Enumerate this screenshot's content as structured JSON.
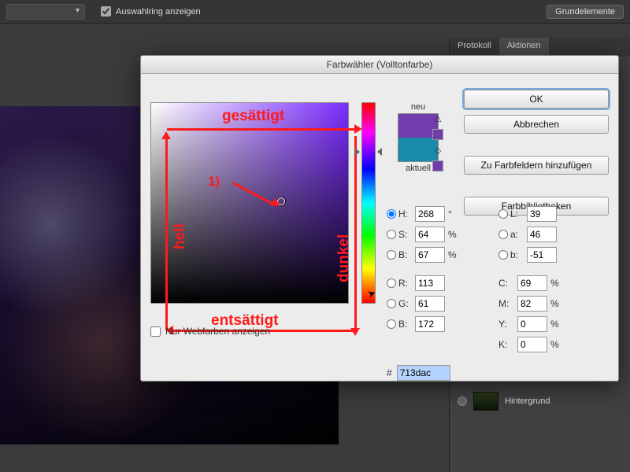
{
  "topbar": {
    "checkbox_label": "Auswahlring anzeigen",
    "right_button": "Grundelemente"
  },
  "panel": {
    "tabs": [
      "Protokoll",
      "Aktionen"
    ],
    "active_tab": 1,
    "layer_name": "Hintergrund"
  },
  "dialog": {
    "title": "Farbwähler (Volltonfarbe)",
    "buttons": {
      "ok": "OK",
      "cancel": "Abbrechen",
      "add_swatch": "Zu Farbfeldern hinzufügen",
      "libraries": "Farbbibliotheken"
    },
    "swatch": {
      "new_label": "neu",
      "current_label": "aktuell"
    },
    "hsb": {
      "h_label": "H:",
      "s_label": "S:",
      "b_label": "B:",
      "h": "268",
      "s": "64",
      "b": "67",
      "deg": "°",
      "pct": "%"
    },
    "rgb": {
      "r_label": "R:",
      "g_label": "G:",
      "b_label": "B:",
      "r": "113",
      "g": "61",
      "b": "172"
    },
    "lab": {
      "l_label": "L:",
      "a_label": "a:",
      "b_label": "b:",
      "l": "39",
      "a": "46",
      "b": "-51"
    },
    "cmyk": {
      "c_label": "C:",
      "m_label": "M:",
      "y_label": "Y:",
      "k_label": "K:",
      "c": "69",
      "m": "82",
      "y": "0",
      "k": "0",
      "pct": "%"
    },
    "hex": {
      "label": "#",
      "value": "713dac"
    },
    "web_only": "Nur Webfarben anzeigen",
    "colors": {
      "new": "#713dac",
      "current": "#1a8aaa"
    }
  },
  "annotations": {
    "top": "gesättigt",
    "bottom": "entsättigt",
    "left": "hell",
    "right": "dunkel",
    "marker": "1)"
  }
}
